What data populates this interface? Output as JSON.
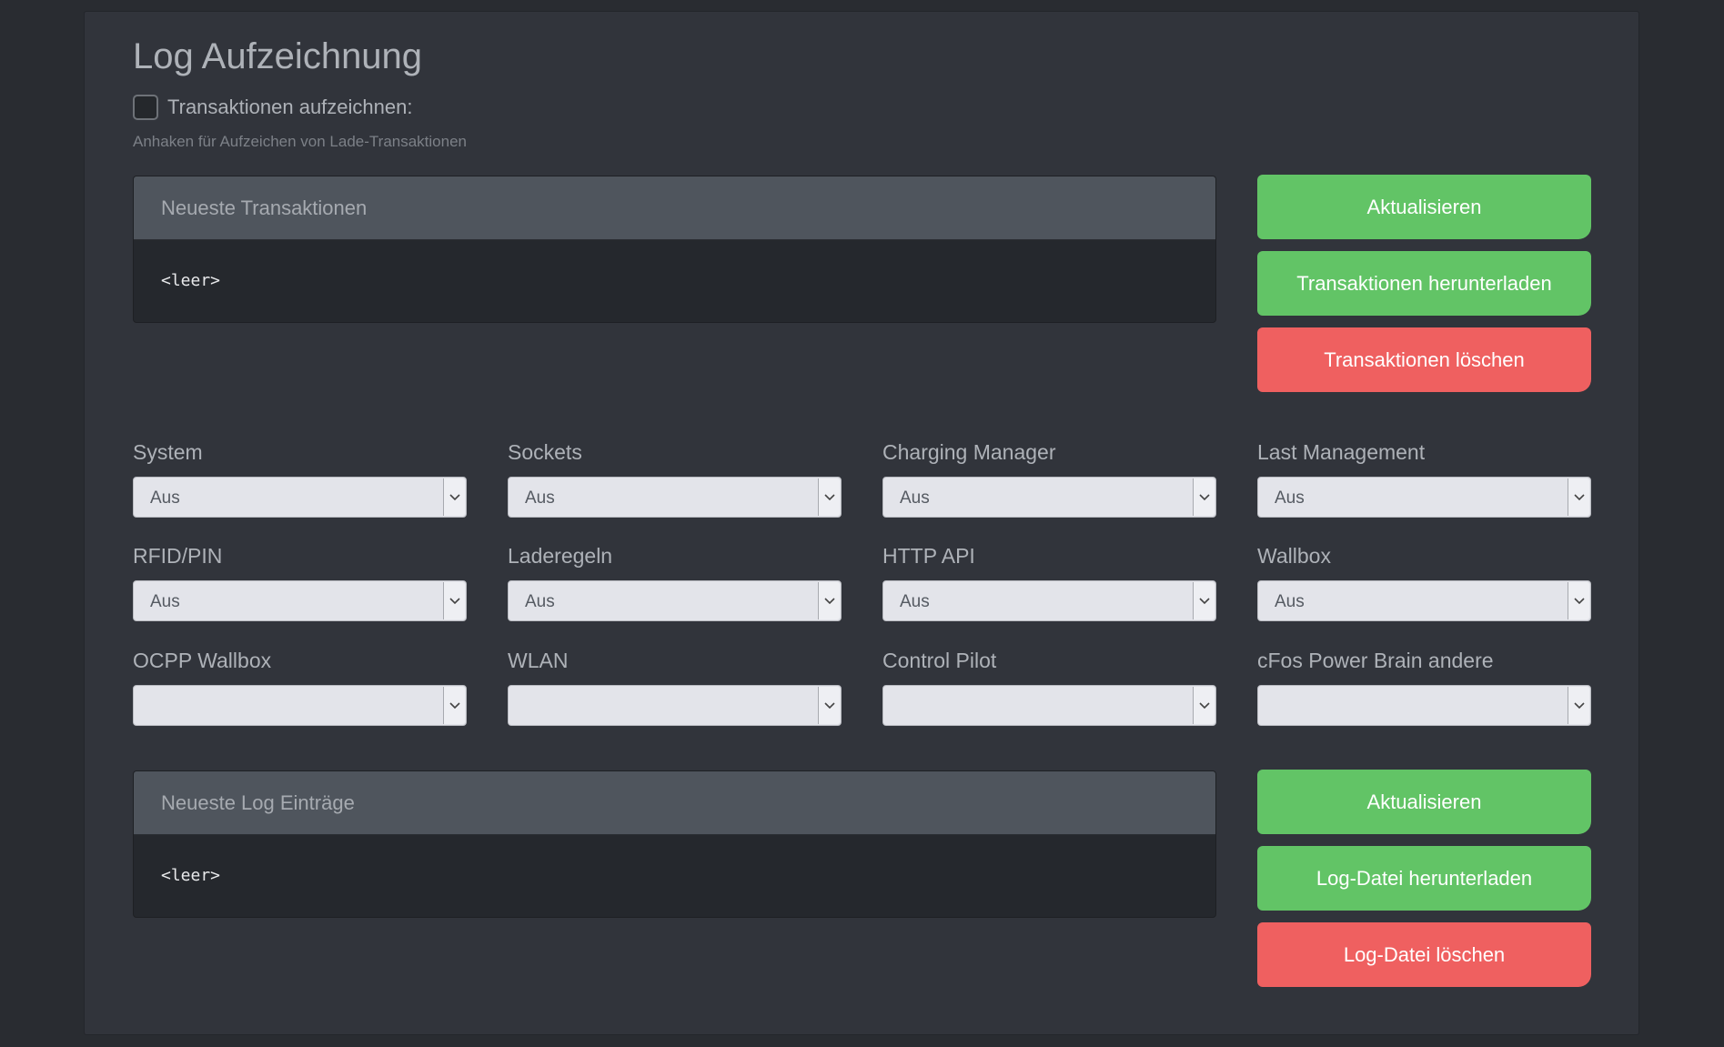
{
  "page": {
    "title": "Log Aufzeichnung",
    "record_checkbox_label": "Transaktionen aufzeichnen:",
    "record_checkbox_checked": false,
    "record_hint": "Anhaken für Aufzeichen von Lade-Transaktionen"
  },
  "transactions": {
    "header": "Neueste Transaktionen",
    "content": "<leer>",
    "buttons": {
      "refresh": "Aktualisieren",
      "download": "Transaktionen herunterladen",
      "delete": "Transaktionen löschen"
    }
  },
  "log_levels": [
    {
      "label": "System",
      "value": "Aus"
    },
    {
      "label": "Sockets",
      "value": "Aus"
    },
    {
      "label": "Charging Manager",
      "value": "Aus"
    },
    {
      "label": "Last Management",
      "value": "Aus"
    },
    {
      "label": "RFID/PIN",
      "value": "Aus"
    },
    {
      "label": "Laderegeln",
      "value": "Aus"
    },
    {
      "label": "HTTP API",
      "value": "Aus"
    },
    {
      "label": "Wallbox",
      "value": "Aus"
    },
    {
      "label": "OCPP Wallbox",
      "value": ""
    },
    {
      "label": "WLAN",
      "value": ""
    },
    {
      "label": "Control Pilot",
      "value": ""
    },
    {
      "label": "cFos Power Brain andere",
      "value": ""
    }
  ],
  "log": {
    "header": "Neueste Log Einträge",
    "content": "<leer>",
    "buttons": {
      "refresh": "Aktualisieren",
      "download": "Log-Datei herunterladen",
      "delete": "Log-Datei löschen"
    }
  },
  "colors": {
    "background": "#292c31",
    "card": "#31343b",
    "panel_header": "#4f555d",
    "panel_body": "#25282d",
    "button_green": "#62c466",
    "button_red": "#ef6060"
  },
  "icons": {
    "select_arrow": "chevron-down-icon"
  }
}
